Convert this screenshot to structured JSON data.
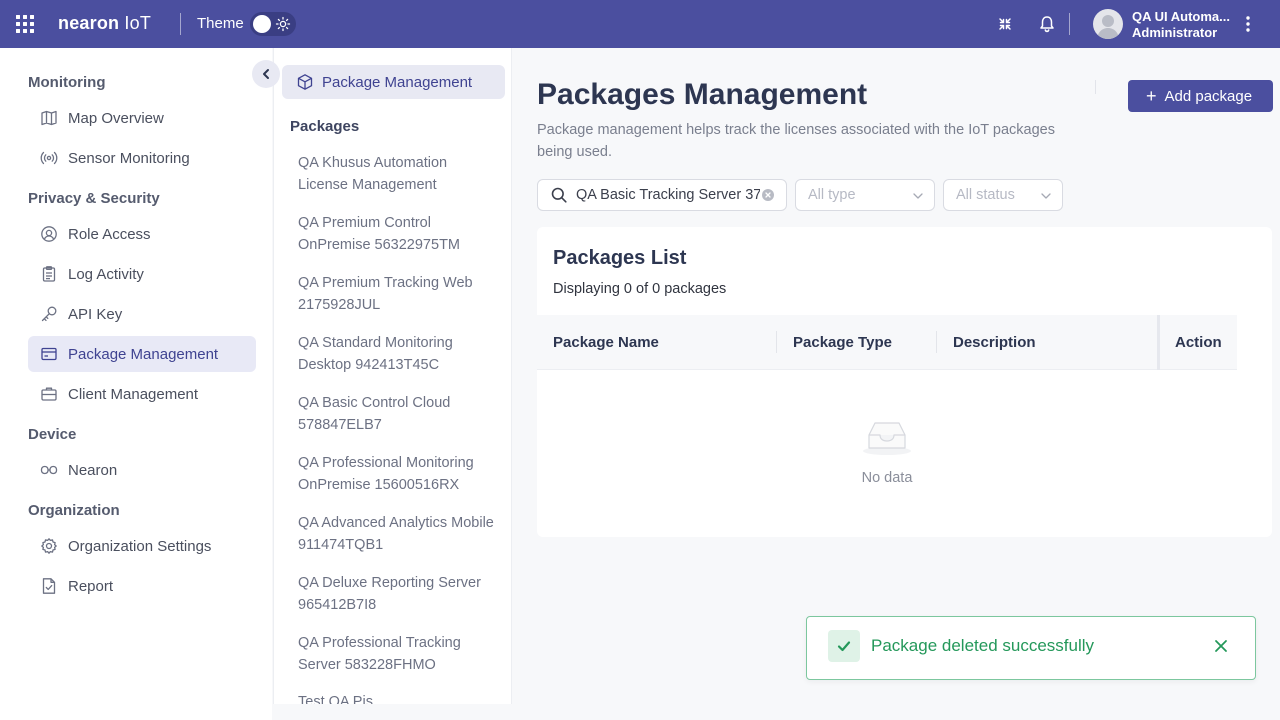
{
  "topbar": {
    "brand_main": "nearon",
    "brand_suffix": " IoT",
    "theme_label": "Theme",
    "user_name": "QA UI Automa...",
    "user_role": "Administrator"
  },
  "sidebar": {
    "sections": {
      "monitoring": "Monitoring",
      "privacy": "Privacy & Security",
      "device": "Device",
      "organization": "Organization"
    },
    "items": {
      "map_overview": "Map Overview",
      "sensor_monitoring": "Sensor Monitoring",
      "role_access": "Role Access",
      "log_activity": "Log Activity",
      "api_key": "API Key",
      "package_management": "Package Management",
      "client_management": "Client Management",
      "nearon": "Nearon",
      "organization_settings": "Organization Settings",
      "report": "Report"
    }
  },
  "subnav": {
    "active_label": "Package Management",
    "packages_heading": "Packages",
    "packages": [
      "QA Khusus Automation License Management",
      "QA Premium Control OnPremise 56322975TM",
      "QA Premium Tracking Web 2175928JUL",
      "QA Standard Monitoring Desktop 942413T45C",
      "QA Basic Control Cloud 578847ELB7",
      "QA Professional Monitoring OnPremise 15600516RX",
      "QA Advanced Analytics Mobile 911474TQB1",
      "QA Deluxe Reporting Server 965412B7I8",
      "QA Professional Tracking Server 583228FHMO",
      "Test QA Pis"
    ]
  },
  "main": {
    "title": "Packages Management",
    "description": "Package management helps track the licenses associated with the IoT packages being used.",
    "add_button": "Add package",
    "search_value": "QA Basic Tracking Server 37",
    "type_placeholder": "All type",
    "status_placeholder": "All status",
    "list_title": "Packages List",
    "list_count": "Displaying 0 of 0 packages",
    "columns": [
      "Package Name",
      "Package Type",
      "Description",
      "Action"
    ],
    "empty_text": "No data"
  },
  "toast": {
    "message": "Package deleted successfully"
  },
  "colors": {
    "brand": "#4b4f9f",
    "active_bg": "#e8e9f6",
    "success": "#24985a"
  }
}
